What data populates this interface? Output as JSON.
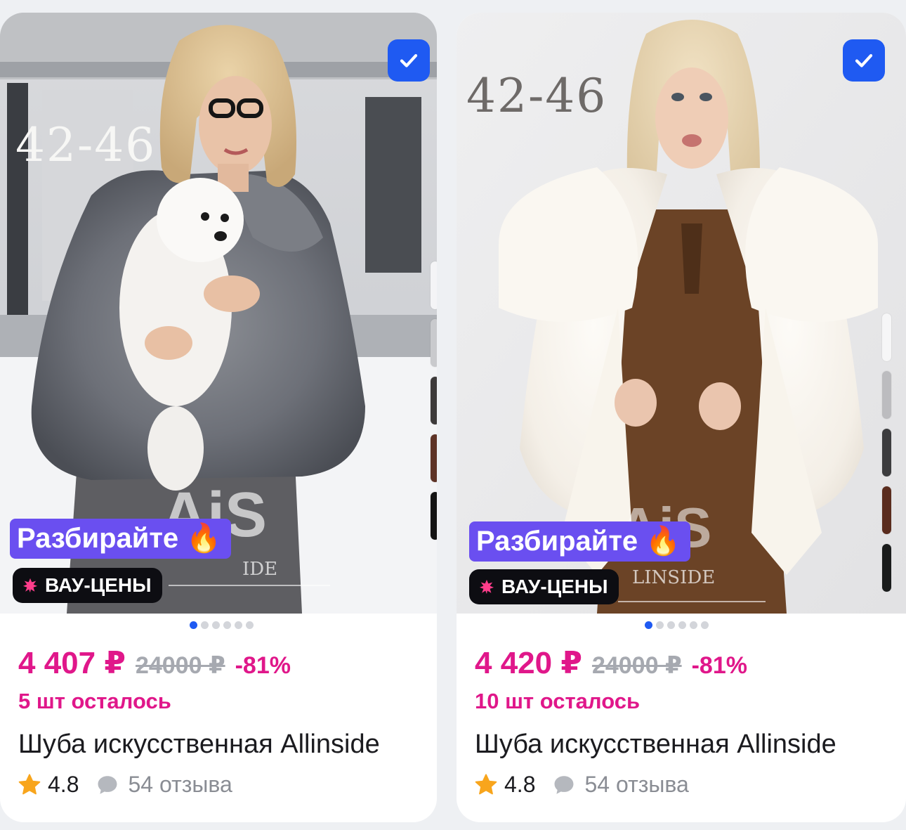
{
  "products": [
    {
      "size_label": "42-46",
      "promo_label": "Разбирайте",
      "promo_icon": "fire-icon",
      "badge_label": "ВАУ-ЦЕНЫ",
      "price": "4 407 ₽",
      "old_price": "24000 ₽",
      "discount": "-81%",
      "stock": "5 шт осталось",
      "title": "Шуба искусственная Allinside",
      "rating": "4.8",
      "reviews": "54 отзыва",
      "selected": true,
      "photo_count": 6,
      "active_photo": 1,
      "color_swatches": [
        "#f4f4f6",
        "#c9cacd",
        "#3d3a3a",
        "#5e3326",
        "#141414"
      ]
    },
    {
      "size_label": "42-46",
      "promo_label": "Разбирайте",
      "promo_icon": "fire-icon",
      "badge_label": "ВАУ-ЦЕНЫ",
      "price": "4 420 ₽",
      "old_price": "24000 ₽",
      "discount": "-81%",
      "stock": "10 шт осталось",
      "title": "Шуба искусственная Allinside",
      "rating": "4.8",
      "reviews": "54 отзыва",
      "selected": true,
      "photo_count": 6,
      "active_photo": 1,
      "color_swatches": [
        "#f6f6f7",
        "#bcbcbf",
        "#3c3c3e",
        "#5a2c1e",
        "#1a1c1c"
      ]
    }
  ],
  "colors": {
    "accent_pink": "#e0178a",
    "promo_purple": "#6a4ff0",
    "check_blue": "#1f5af2",
    "star_yellow": "#f8a51c"
  }
}
